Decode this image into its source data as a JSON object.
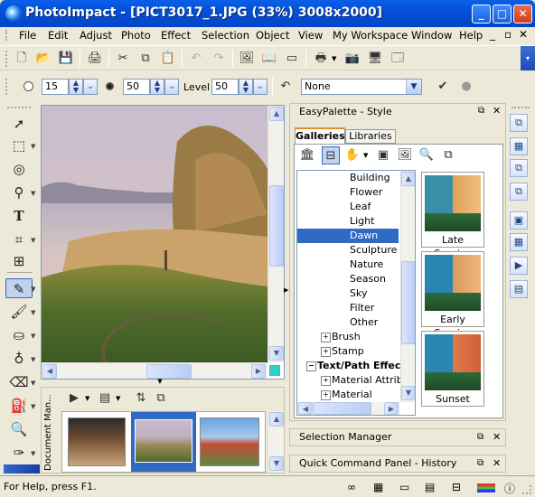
{
  "window": {
    "title": "PhotoImpact - [PICT3017_1.JPG (33%) 3008x2000]",
    "minimize": "_",
    "maximize": "□",
    "close": "✕"
  },
  "menu": {
    "items": [
      "File",
      "Edit",
      "Adjust",
      "Photo",
      "Effect",
      "Selection",
      "Object",
      "View",
      "My Workspace",
      "Window",
      "Help"
    ],
    "mdi_controls": [
      "_",
      "▫",
      "✕"
    ]
  },
  "toolbar_attrs": {
    "field1_value": "15",
    "field2_value": "50",
    "level_label": "Level",
    "level_value": "50",
    "preset_value": "None"
  },
  "easypalette": {
    "title": "EasyPalette - Style",
    "tabs": [
      "Galleries",
      "Libraries"
    ],
    "gallery_items": [
      {
        "label": "Building",
        "selected": false
      },
      {
        "label": "Flower",
        "selected": false
      },
      {
        "label": "Leaf",
        "selected": false
      },
      {
        "label": "Light",
        "selected": false
      },
      {
        "label": "Dawn",
        "selected": true
      },
      {
        "label": "Sculpture",
        "selected": false
      },
      {
        "label": "Nature",
        "selected": false
      },
      {
        "label": "Season",
        "selected": false
      },
      {
        "label": "Sky",
        "selected": false
      },
      {
        "label": "Filter",
        "selected": false
      },
      {
        "label": "Other",
        "selected": false
      }
    ],
    "tree_items": [
      {
        "label": "Brush",
        "expanded": false,
        "indent": 1,
        "bold": false
      },
      {
        "label": "Stamp",
        "expanded": false,
        "indent": 1,
        "bold": false
      },
      {
        "label": "Text/Path Effect",
        "expanded": true,
        "indent": 0,
        "bold": true
      },
      {
        "label": "Material Attribu",
        "expanded": false,
        "indent": 1,
        "bold": false
      },
      {
        "label": "Material",
        "expanded": false,
        "indent": 1,
        "bold": false
      }
    ],
    "thumbnails": [
      {
        "label": "Late Sunrise"
      },
      {
        "label": "Early Sunrise"
      },
      {
        "label": "Sunset"
      }
    ]
  },
  "panels": {
    "selection_manager": "Selection Manager",
    "quick_command": "Quick Command Panel - History"
  },
  "document_manager": {
    "label": "Document Man..."
  },
  "status": {
    "help_text": "For Help, press F1."
  },
  "colors": {
    "title_bar": "#0450d8",
    "selection": "#316ac5",
    "panel_bg": "#ece9d8"
  }
}
